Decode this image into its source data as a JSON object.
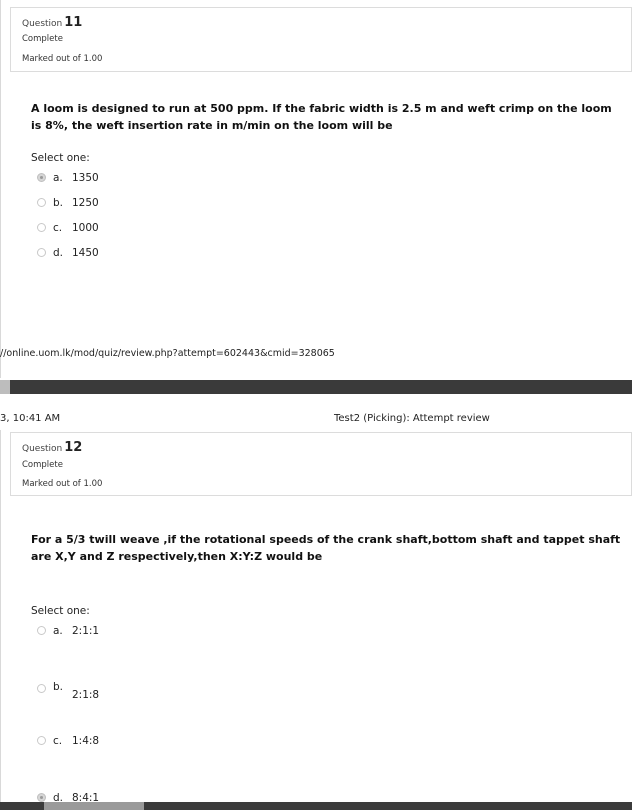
{
  "q11": {
    "label": "Question",
    "number": "11",
    "status": "Complete",
    "marks": "Marked out of 1.00",
    "text": "A loom is designed to run at 500 ppm. If the fabric width is 2.5 m and weft crimp on the loom is 8%, the weft insertion rate in m/min on the loom will be",
    "select_label": "Select one:",
    "options": [
      {
        "letter": "a.",
        "value": "1350",
        "selected": true
      },
      {
        "letter": "b.",
        "value": "1250",
        "selected": false
      },
      {
        "letter": "c.",
        "value": "1000",
        "selected": false
      },
      {
        "letter": "d.",
        "value": "1450",
        "selected": false
      }
    ]
  },
  "footer_url": "//online.uom.lk/mod/quiz/review.php?attempt=602443&cmid=328065",
  "page_header": {
    "time": "3, 10:41 AM",
    "title": "Test2 (Picking): Attempt review"
  },
  "q12": {
    "label": "Question",
    "number": "12",
    "status": "Complete",
    "marks": "Marked out of 1.00",
    "text": "For a 5/3 twill weave ,if the rotational speeds of the crank shaft,bottom shaft and tappet shaft are X,Y and Z respectively,then X:Y:Z would be",
    "select_label": "Select one:",
    "options": [
      {
        "letter": "a.",
        "value": "2:1:1",
        "selected": false
      },
      {
        "letter": "b.",
        "value": "2:1:8",
        "selected": false
      },
      {
        "letter": "c.",
        "value": "1:4:8",
        "selected": false
      },
      {
        "letter": "d.",
        "value": "8:4:1",
        "selected": true
      }
    ]
  }
}
